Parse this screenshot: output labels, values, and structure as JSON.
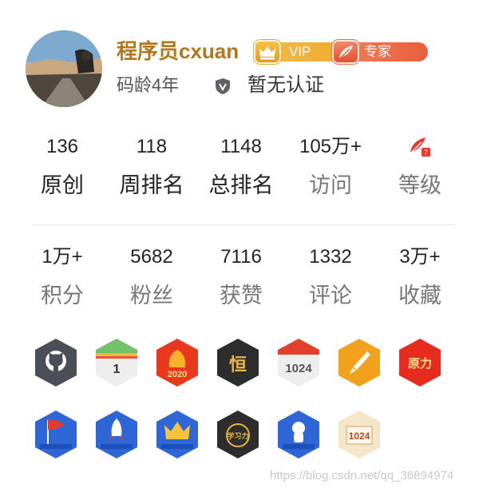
{
  "profile": {
    "name": "程序员cxuan",
    "vip_label": "VIP",
    "expert_label": "专家",
    "code_age": "码龄4年",
    "certification": "暂无认证"
  },
  "stats_row1": [
    {
      "value": "136",
      "label": "原创"
    },
    {
      "value": "118",
      "label": "周排名"
    },
    {
      "value": "1148",
      "label": "总排名"
    },
    {
      "value": "105万+",
      "label": "访问"
    },
    {
      "value": "",
      "label": "等级",
      "icon": "level-pen-icon"
    }
  ],
  "stats_row2": [
    {
      "value": "1万+",
      "label": "积分"
    },
    {
      "value": "5682",
      "label": "粉丝"
    },
    {
      "value": "7116",
      "label": "获赞"
    },
    {
      "value": "1332",
      "label": "评论"
    },
    {
      "value": "3万+",
      "label": "收藏"
    }
  ],
  "badges_row1": [
    {
      "name": "github-badge-icon",
      "color": "#4a4f57"
    },
    {
      "name": "calendar-1day-badge-icon",
      "color": "#eeeeee",
      "text": "1"
    },
    {
      "name": "badge-2020-icon",
      "color": "#e8391f",
      "text": "2020"
    },
    {
      "name": "persistence-badge-icon",
      "color": "#2d2d2d",
      "text": "恒"
    },
    {
      "name": "badge-1024-icon",
      "color": "#eeeeee",
      "text": "1024"
    },
    {
      "name": "fountain-pen-badge-icon",
      "color": "#f2a11d"
    },
    {
      "name": "yuanli-badge-icon",
      "color": "#e62c1f",
      "text": "原力"
    }
  ],
  "badges_row2": [
    {
      "name": "yuanli-explore-badge-icon",
      "color": "#2f66d6"
    },
    {
      "name": "yuanli-breakthrough-badge-icon",
      "color": "#2f66d6"
    },
    {
      "name": "yuanli-king-badge-icon",
      "color": "#2f66d6"
    },
    {
      "name": "learning-badge-icon",
      "color": "#2d2d2d",
      "text": "学习力"
    },
    {
      "name": "yuanli-newcomer-badge-icon",
      "color": "#2f66d6"
    },
    {
      "name": "badge-1024-scroll-icon",
      "color": "#f3e6c9",
      "text": "1024"
    }
  ],
  "watermark": "https://blog.csdn.net/qq_36894974",
  "colors": {
    "name": "#b5771c",
    "vip": "#f0a92d",
    "expert": "#e85f3c",
    "label_grey": "#777777"
  }
}
